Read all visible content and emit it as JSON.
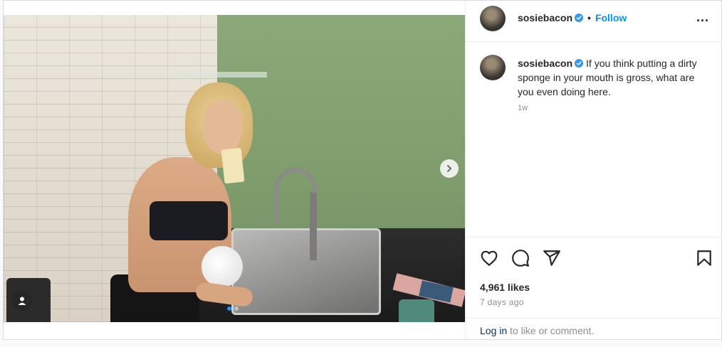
{
  "header": {
    "username": "sosiebacon",
    "separator": "•",
    "follow_label": "Follow",
    "more_label": "..."
  },
  "caption": {
    "username": "sosiebacon",
    "text": "If you think putting a dirty sponge in your mouth is gross, what are you even doing here.",
    "time": "1w"
  },
  "engagement": {
    "likes": "4,961 likes",
    "posted": "7 days ago"
  },
  "login": {
    "link_label": "Log in",
    "rest": " to like or comment."
  },
  "carousel": {
    "total_slides": 2,
    "current_slide": 1
  },
  "icons": {
    "like": "heart-icon",
    "comment": "comment-icon",
    "share": "send-icon",
    "save": "bookmark-icon",
    "next": "chevron-right-icon",
    "tag": "user-tag-icon",
    "verified": "verified-badge-icon"
  },
  "colors": {
    "link": "#0095f6",
    "verified": "#3897f0",
    "text": "#262626",
    "muted": "#8e8e8e"
  }
}
